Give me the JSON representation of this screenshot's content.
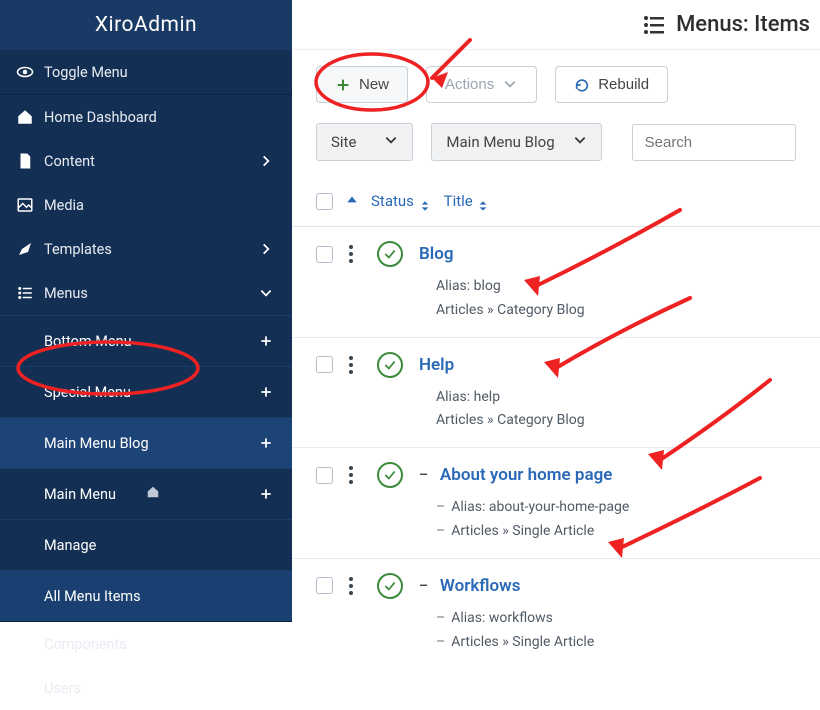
{
  "sidebar": {
    "brand": "XiroAdmin",
    "items": [
      {
        "label": "Toggle Menu"
      },
      {
        "label": "Home Dashboard"
      },
      {
        "label": "Content"
      },
      {
        "label": "Media"
      },
      {
        "label": "Templates"
      },
      {
        "label": "Menus"
      },
      {
        "label": "Components"
      },
      {
        "label": "Users"
      }
    ],
    "menus_sub": [
      {
        "label": "Bottom Menu"
      },
      {
        "label": "Special Menu"
      },
      {
        "label": "Main Menu Blog"
      },
      {
        "label": "Main Menu"
      },
      {
        "label": "Manage"
      },
      {
        "label": "All Menu Items"
      }
    ]
  },
  "header": {
    "title": "Menus: Items"
  },
  "toolbar": {
    "new_label": "New",
    "actions_label": "Actions",
    "rebuild_label": "Rebuild"
  },
  "filters": {
    "site_label": "Site",
    "menu_label": "Main Menu Blog",
    "search_placeholder": "Search"
  },
  "table": {
    "status_label": "Status",
    "title_label": "Title",
    "rows": [
      {
        "title": "Blog",
        "alias_prefix": "Alias: ",
        "alias": "blog",
        "type": "Articles » Category Blog",
        "nested": false
      },
      {
        "title": "Help",
        "alias_prefix": "Alias: ",
        "alias": "help",
        "type": "Articles » Category Blog",
        "nested": false
      },
      {
        "title": "About your home page",
        "alias_prefix": "Alias: ",
        "alias": "about-your-home-page",
        "type": "Articles » Single Article",
        "nested": true
      },
      {
        "title": "Workflows",
        "alias_prefix": "Alias: ",
        "alias": "workflows",
        "type": "Articles » Single Article",
        "nested": true
      }
    ]
  }
}
